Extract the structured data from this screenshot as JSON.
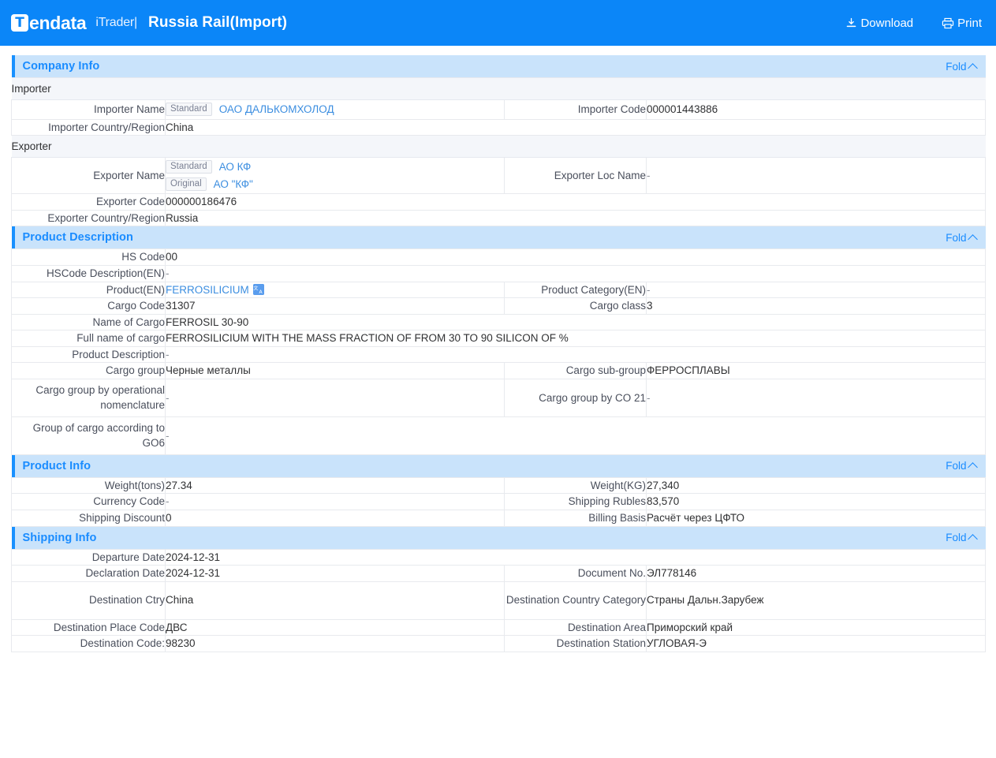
{
  "header": {
    "logo_mark": "T",
    "logo_word": "endata",
    "brand_sub": "iTrader|",
    "page_title": "Russia Rail(Import)",
    "download_label": "Download",
    "print_label": "Print",
    "brand_color": "#0b86f8"
  },
  "fold_label": "Fold",
  "sections": [
    {
      "id": "company-info",
      "title": "Company Info",
      "groups": [
        {
          "name": "Importer",
          "rows": [
            {
              "label": "Importer Name",
              "type": "tags",
              "tags": [
                {
                  "tag": "Standard",
                  "text": "ОАО ДАЛЬКОМХОЛОД"
                }
              ],
              "label2": "Importer Code",
              "value2": "000001443886"
            },
            {
              "label": "Importer Country/Region",
              "value": "China",
              "full": true
            }
          ]
        },
        {
          "name": "Exporter",
          "rows": [
            {
              "label": "Exporter Name",
              "type": "tags",
              "tags": [
                {
                  "tag": "Standard",
                  "text": "АО КФ"
                },
                {
                  "tag": "Original",
                  "text": "АО \"КФ\""
                }
              ],
              "label2": "Exporter Loc Name",
              "value2": "-"
            },
            {
              "label": "Exporter Code",
              "value": "000000186476",
              "full": true
            },
            {
              "label": "Exporter Country/Region",
              "value": "Russia",
              "full": true
            }
          ]
        }
      ]
    },
    {
      "id": "product-description",
      "title": "Product Description",
      "groups": [
        {
          "name": null,
          "rows": [
            {
              "label": "HS Code",
              "value": "00",
              "full": true
            },
            {
              "label": "HSCode Description(EN)",
              "value": "-",
              "full": true
            },
            {
              "label": "Product(EN)",
              "value": "FERROSILICIUM",
              "link": true,
              "translate": true,
              "label2": "Product Category(EN)",
              "value2": "-"
            },
            {
              "label": "Cargo Code",
              "value": "31307",
              "label2": "Cargo class",
              "value2": "3"
            },
            {
              "label": "Name of Cargo",
              "value": "FERROSIL 30-90",
              "full": true
            },
            {
              "label": "Full name of cargo",
              "value": "FERROSILICIUM WITH THE MASS FRACTION OF FROM 30 TO 90 SILICON OF %",
              "full": true
            },
            {
              "label": "Product Description",
              "value": "-",
              "full": true
            },
            {
              "label": "Cargo group",
              "value": "Черные металлы",
              "label2": "Cargo sub-group",
              "value2": "ФЕРРОСПЛАВЫ"
            },
            {
              "label": "Cargo group by operational nomenclature",
              "value": "-",
              "label2": "Cargo group by CO 21",
              "value2": "-",
              "tall": true
            },
            {
              "label": "Group of cargo according to GO6",
              "value": "-",
              "full": true,
              "tall": true
            }
          ]
        }
      ]
    },
    {
      "id": "product-info",
      "title": "Product Info",
      "groups": [
        {
          "name": null,
          "rows": [
            {
              "label": "Weight(tons)",
              "value": "27.34",
              "label2": "Weight(KG)",
              "value2": "27,340"
            },
            {
              "label": "Currency Code",
              "value": "-",
              "label2": "Shipping Rubles",
              "value2": "83,570"
            },
            {
              "label": "Shipping Discount",
              "value": "0",
              "label2": "Billing Basis",
              "value2": "Расчёт через ЦФТО"
            }
          ]
        }
      ]
    },
    {
      "id": "shipping-info",
      "title": "Shipping Info",
      "groups": [
        {
          "name": null,
          "rows": [
            {
              "label": "Departure Date",
              "value": "2024-12-31",
              "full": true
            },
            {
              "label": "Declaration Date",
              "value": "2024-12-31",
              "label2": "Document No.",
              "value2": "ЭЛ778146"
            },
            {
              "label": "Destination Ctry",
              "value": "China",
              "label2": "Destination Country Category",
              "value2": "Страны Дальн.Зарубеж",
              "tall": true
            },
            {
              "label": "Destination Place Code",
              "value": "ДВС",
              "label2": "Destination Area",
              "value2": "Приморский край"
            },
            {
              "label": "Destination Code:",
              "value": "98230",
              "label2": "Destination Station",
              "value2": "УГЛОВАЯ-Э"
            }
          ]
        }
      ]
    }
  ]
}
